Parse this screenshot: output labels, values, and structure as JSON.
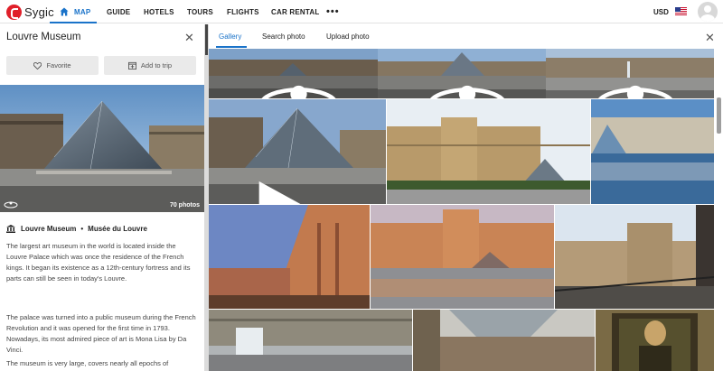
{
  "app": {
    "brand": "Sygic",
    "nav": [
      {
        "label": "MAP",
        "active": true
      },
      {
        "label": "GUIDE"
      },
      {
        "label": "HOTELS"
      },
      {
        "label": "TOURS"
      },
      {
        "label": "FLIGHTS"
      },
      {
        "label": "CAR RENTAL"
      }
    ],
    "more": "•••",
    "currency": "USD"
  },
  "place": {
    "title": "Louvre Museum",
    "favorite_label": "Favorite",
    "add_to_trip_label": "Add to trip",
    "photo_count": "70 photos",
    "name": "Louvre Museum",
    "separator": "•",
    "local_name": "Musée du Louvre",
    "paragraphs": [
      "The largest art museum in the world is located inside the Louvre Palace which was once the residence of the French kings. It began its existence as a 12th-century fortress and its parts can still be seen in today's Louvre.",
      "The palace was turned into a public museum during the French Revolution and it was opened for the first time in 1793. Nowadays, its most admired piece of art is Mona Lisa by Da Vinci.",
      "The museum is very large, covers nearly all epochs of"
    ]
  },
  "gallery": {
    "tabs": [
      "Gallery",
      "Search photo",
      "Upload photo"
    ],
    "active_tab": "Gallery"
  },
  "colors": {
    "accent": "#1a73c9",
    "brand_red": "#e0202a"
  }
}
